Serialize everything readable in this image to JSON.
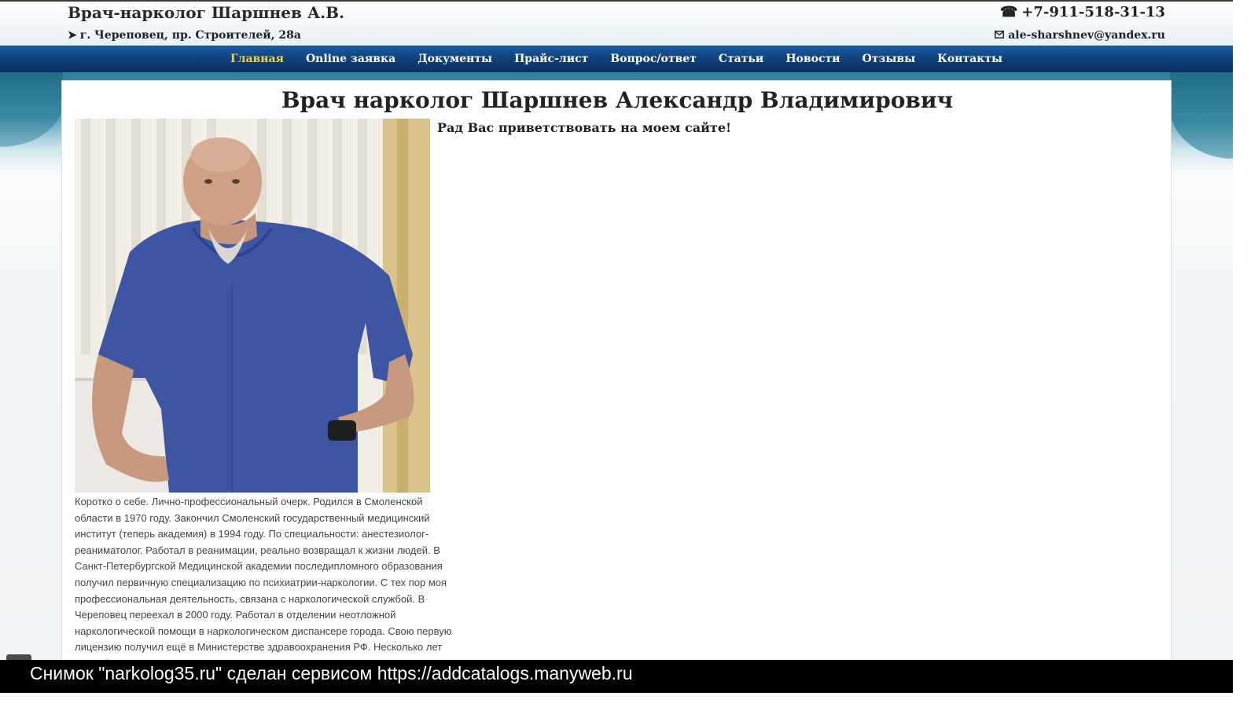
{
  "header": {
    "site_title": "Врач-нарколог Шаршнев А.В.",
    "address": "г. Череповец, пр. Строителей, 28а",
    "phone": "+7-911-518-31-13",
    "email": "ale-sharshnev@yandex.ru",
    "address_icon": "arrow-right-icon",
    "phone_icon": "phone-icon",
    "email_icon": "envelope-icon"
  },
  "nav": {
    "items": [
      {
        "label": "Главная",
        "active": true
      },
      {
        "label": "Online заявка"
      },
      {
        "label": "Документы"
      },
      {
        "label": "Прайс-лист"
      },
      {
        "label": "Вопрос/ответ"
      },
      {
        "label": "Статьи"
      },
      {
        "label": "Новости"
      },
      {
        "label": "Отзывы"
      },
      {
        "label": "Контакты"
      }
    ]
  },
  "main": {
    "title": "Врач нарколог Шаршнев Александр Владимирович",
    "greeting": "Рад Вас приветствовать на моем сайте!",
    "bio": "Коротко о себе. Лично-профессиональный очерк. Родился в Смоленской области в 1970 году. Закончил Смоленский государственный медицинский институт (теперь академия) в 1994 году. По специальности: анестезиолог-реаниматолог. Работал в реанимации, реально возвращал к жизни людей. В Санкт-Петербургской Медицинской академии последипломного образования получил первичную специализацию по психиатрии-наркологии. С тех пор моя профессиональная деятельность, связана с наркологической службой. В Череповец переехал в 2000 году. Работал в отделении неотложной наркологической помощи в наркологическом диспансере города. Свою первую лицензию получил ещё в Министерстве здравоохранения РФ. Несколько лет проработав. Также поменял ..."
  },
  "footer": {
    "caption": "Снимок \"narkolog35.ru\" сделан сервисом https://addcatalogs.manyweb.ru"
  },
  "colors": {
    "nav_bg": "#0d3f78",
    "nav_active": "#f4d23c",
    "accent_teal": "#2f7f9a"
  }
}
